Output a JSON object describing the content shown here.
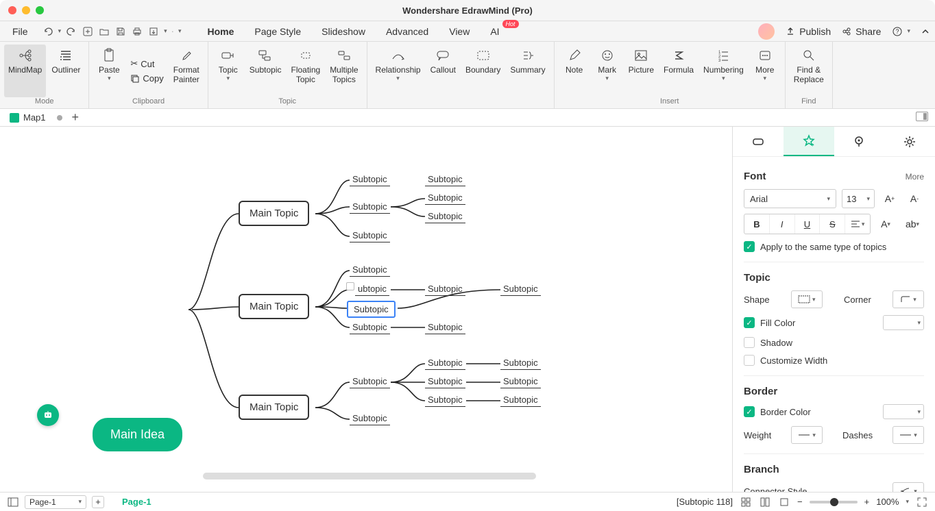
{
  "app_title": "Wondershare EdrawMind (Pro)",
  "menubar": {
    "file": "File",
    "tabs": [
      "Home",
      "Page Style",
      "Slideshow",
      "Advanced",
      "View",
      "AI"
    ],
    "active_tab": "Home",
    "hot": "Hot",
    "publish": "Publish",
    "share": "Share"
  },
  "ribbon": {
    "mode": {
      "label": "Mode",
      "mindmap": "MindMap",
      "outliner": "Outliner"
    },
    "clipboard": {
      "label": "Clipboard",
      "paste": "Paste",
      "cut": "Cut",
      "copy": "Copy",
      "format_painter": "Format\nPainter"
    },
    "topic": {
      "label": "Topic",
      "topic": "Topic",
      "subtopic": "Subtopic",
      "floating": "Floating\nTopic",
      "multiple": "Multiple\nTopics"
    },
    "relationship": "Relationship",
    "callout": "Callout",
    "boundary": "Boundary",
    "summary": "Summary",
    "insert": {
      "label": "Insert",
      "note": "Note",
      "mark": "Mark",
      "picture": "Picture",
      "formula": "Formula",
      "numbering": "Numbering",
      "more": "More"
    },
    "find": {
      "label": "Find",
      "find_replace": "Find &\nReplace"
    }
  },
  "doc": {
    "name": "Map1",
    "page_selector": "Page-1",
    "page_tab": "Page-1"
  },
  "mindmap": {
    "root": "Main Idea",
    "mains": [
      "Main Topic",
      "Main Topic",
      "Main Topic"
    ],
    "sub": "Subtopic"
  },
  "panel": {
    "font": {
      "title": "Font",
      "more": "More",
      "family": "Arial",
      "size": "13",
      "apply": "Apply to the same type of topics"
    },
    "topic": {
      "title": "Topic",
      "shape": "Shape",
      "corner": "Corner",
      "fill": "Fill Color",
      "shadow": "Shadow",
      "customize": "Customize Width"
    },
    "border": {
      "title": "Border",
      "color": "Border Color",
      "weight": "Weight",
      "dashes": "Dashes",
      "swatch": "#3a3a3a"
    },
    "branch": {
      "title": "Branch",
      "connector": "Connector Style"
    }
  },
  "status": {
    "selection": "[Subtopic 118]",
    "zoom": "100%"
  }
}
